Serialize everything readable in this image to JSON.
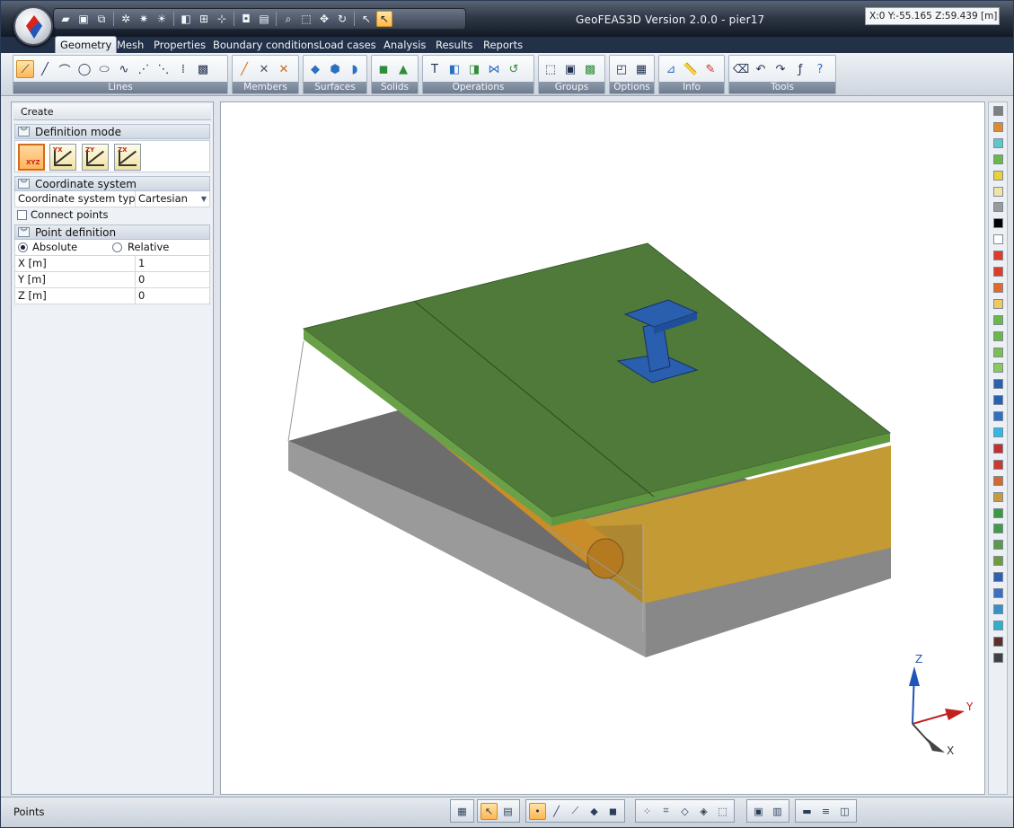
{
  "window": {
    "title": "GeoFEAS3D Version 2.0.0 - pier17",
    "controls": {
      "minimize": "–",
      "maximize": "▭",
      "close": "✕"
    }
  },
  "quick_access": [
    {
      "icon": "folder-open-icon",
      "glyph": "▰"
    },
    {
      "icon": "save-icon",
      "glyph": "▣"
    },
    {
      "icon": "export-icon",
      "glyph": "⧉"
    },
    {
      "icon": "gear-refresh-icon",
      "glyph": "✲"
    },
    {
      "icon": "gear-mesh-icon",
      "glyph": "✷"
    },
    {
      "icon": "sun-light-icon",
      "glyph": "☀"
    },
    {
      "icon": "view-cube-icon",
      "glyph": "◧"
    },
    {
      "icon": "render-mode-icon",
      "glyph": "⊞"
    },
    {
      "icon": "section-icon",
      "glyph": "⊹"
    },
    {
      "icon": "camera-icon",
      "glyph": "◘"
    },
    {
      "icon": "snapshot-icon",
      "glyph": "▤"
    },
    {
      "icon": "zoom-icon",
      "glyph": "⌕"
    },
    {
      "icon": "zoom-window-icon",
      "glyph": "⬚"
    },
    {
      "icon": "pan-icon",
      "glyph": "✥"
    },
    {
      "icon": "rotate-icon",
      "glyph": "↻"
    },
    {
      "icon": "pointer-icon",
      "glyph": "↖"
    },
    {
      "icon": "pick-pointer-icon",
      "glyph": "↖"
    }
  ],
  "tabs": [
    "Geometry",
    "Mesh",
    "Properties",
    "Boundary conditions",
    "Load cases",
    "Analysis",
    "Results",
    "Reports"
  ],
  "active_tab": "Geometry",
  "ribbon": {
    "groups": [
      {
        "label": "Lines",
        "icons": [
          "point-icon",
          "line-icon",
          "arc-icon",
          "circle-icon",
          "ellipse-icon",
          "spline-icon",
          "split-line-icon",
          "join-line-icon",
          "divide-line-icon",
          "line-props-icon"
        ]
      },
      {
        "label": "Members",
        "icons": [
          "member-icon",
          "member-delete-icon",
          "member-split-icon"
        ]
      },
      {
        "label": "Surfaces",
        "icons": [
          "surface-plane-icon",
          "surface-extrude-icon",
          "surface-revolve-icon"
        ]
      },
      {
        "label": "Solids",
        "icons": [
          "solid-box-icon",
          "solid-prism-icon"
        ]
      },
      {
        "label": "Operations",
        "icons": [
          "text-op-icon",
          "copy-op-icon",
          "move-op-icon",
          "mirror-op-icon",
          "rotate-op-icon"
        ]
      },
      {
        "label": "Groups",
        "icons": [
          "group-select-icon",
          "group-box-icon",
          "group-solid-icon"
        ]
      },
      {
        "label": "Options",
        "icons": [
          "options-window-icon",
          "grid-icon"
        ]
      },
      {
        "label": "Info",
        "icons": [
          "measure-icon",
          "ruler-icon",
          "probe-icon"
        ]
      },
      {
        "label": "Tools",
        "icons": [
          "eraser-icon",
          "undo-icon",
          "redo-icon",
          "script-icon",
          "help-icon"
        ]
      }
    ]
  },
  "panel": {
    "title": "Create",
    "definition_mode": {
      "label": "Definition mode",
      "modes": [
        "xyz-mode-icon",
        "yx-mode-icon",
        "zy-mode-icon",
        "zx-mode-icon"
      ],
      "tags": [
        "XYZ",
        "YX",
        "ZY",
        "ZX"
      ]
    },
    "coordinate_system": {
      "label": "Coordinate system",
      "type_label": "Coordinate system typ",
      "type_value": "Cartesian"
    },
    "connect_points": "Connect points",
    "point_definition": {
      "label": "Point definition",
      "absolute": "Absolute",
      "relative": "Relative",
      "selected": "Absolute"
    },
    "fields": [
      {
        "name": "X  [m]",
        "value": "1"
      },
      {
        "name": "Y  [m]",
        "value": "0"
      },
      {
        "name": "Z  [m]",
        "value": "0"
      }
    ]
  },
  "axes": {
    "z": "Z",
    "y": "Y",
    "x": "X"
  },
  "palette": [
    "#808080",
    "#e08a2b",
    "#5ec8c8",
    "#6ab84a",
    "#e6d23a",
    "#efe4a8",
    "#9a9a9a",
    "#000000",
    "#ffffff",
    "#e03a2a",
    "#e03a2a",
    "#e06a2a",
    "#f0c860",
    "#6ab84a",
    "#6ab84a",
    "#7ac050",
    "#8ac860",
    "#2a60b0",
    "#2a60b0",
    "#3070c0",
    "#30b8e8",
    "#c03030",
    "#c83a30",
    "#d06a30",
    "#c89a40",
    "#3a9a40",
    "#409a48",
    "#5a9a48",
    "#709a40",
    "#3060b0",
    "#3a70c0",
    "#3890c8",
    "#30b0c8",
    "#603028",
    "#404040"
  ],
  "status": {
    "text": "Points",
    "coords": "X:0 Y:-55.165 Z:59.439 [m]"
  },
  "colors": {
    "ground": "#4f7a3a",
    "soil": "#c39a34",
    "base": "#8a8a8a",
    "pier": "#2a5fb0",
    "pipe": "#c88c28"
  }
}
